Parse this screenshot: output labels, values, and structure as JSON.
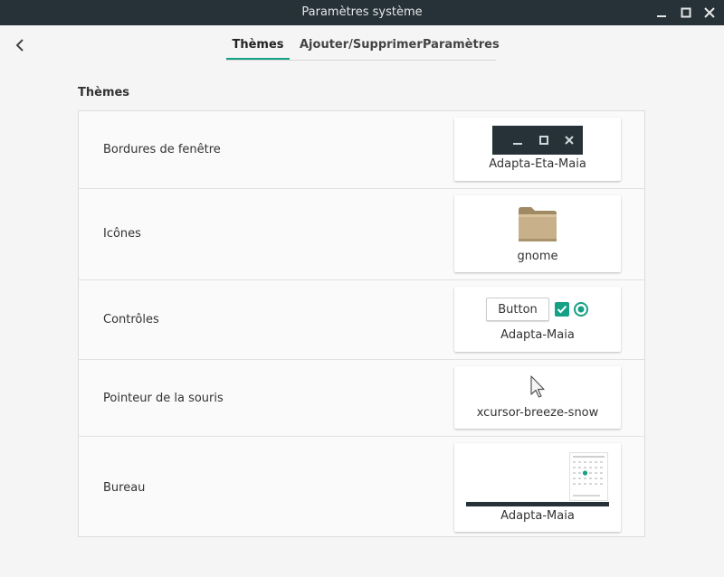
{
  "window": {
    "title": "Paramètres système"
  },
  "tabs": [
    {
      "label": "Thèmes",
      "active": true
    },
    {
      "label": "Ajouter/Supprimer",
      "active": false
    },
    {
      "label": "Paramètres",
      "active": false
    }
  ],
  "section": {
    "title": "Thèmes"
  },
  "rows": [
    {
      "label": "Bordures de fenêtre",
      "value": "Adapta-Eta-Maia"
    },
    {
      "label": "Icônes",
      "value": "gnome"
    },
    {
      "label": "Contrôles",
      "value": "Adapta-Maia"
    },
    {
      "label": "Pointeur de la souris",
      "value": "xcursor-breeze-snow"
    },
    {
      "label": "Bureau",
      "value": "Adapta-Maia"
    }
  ],
  "controls_preview": {
    "button_label": "Button"
  },
  "colors": {
    "titlebar": "#263238",
    "accent": "#16a085",
    "background": "#f5f5f5"
  },
  "icons": {
    "back": "chevron-left-icon",
    "minimize": "minimize-icon",
    "maximize": "maximize-icon",
    "close": "close-icon",
    "folder": "folder-icon",
    "cursor": "cursor-arrow-icon"
  }
}
